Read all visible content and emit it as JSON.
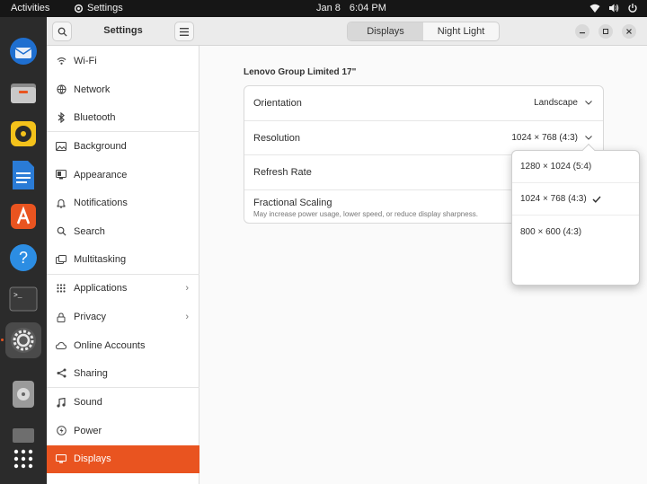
{
  "topbar": {
    "activities": "Activities",
    "app_name": "Settings",
    "date": "Jan 8",
    "time": "6:04 PM"
  },
  "dock": {
    "items": [
      "thunderbird",
      "files",
      "rhythmbox",
      "libreoffice-writer",
      "app-center",
      "help",
      "terminal",
      "settings",
      "disks",
      "trash",
      "show-apps"
    ]
  },
  "sidebar": {
    "title": "Settings",
    "items": [
      {
        "label": "Wi-Fi",
        "icon": "wifi-icon"
      },
      {
        "label": "Network",
        "icon": "network-icon"
      },
      {
        "label": "Bluetooth",
        "icon": "bluetooth-icon"
      },
      {
        "label": "Background",
        "icon": "background-icon"
      },
      {
        "label": "Appearance",
        "icon": "appearance-icon"
      },
      {
        "label": "Notifications",
        "icon": "bell-icon"
      },
      {
        "label": "Search",
        "icon": "search-icon"
      },
      {
        "label": "Multitasking",
        "icon": "multitasking-icon"
      },
      {
        "label": "Applications",
        "icon": "applications-icon"
      },
      {
        "label": "Privacy",
        "icon": "lock-icon"
      },
      {
        "label": "Online Accounts",
        "icon": "cloud-icon"
      },
      {
        "label": "Sharing",
        "icon": "share-icon"
      },
      {
        "label": "Sound",
        "icon": "music-note-icon"
      },
      {
        "label": "Power",
        "icon": "power-icon"
      },
      {
        "label": "Displays",
        "icon": "display-icon"
      }
    ],
    "selected": "Displays"
  },
  "header": {
    "tabs": [
      "Displays",
      "Night Light"
    ],
    "active_tab": "Displays"
  },
  "main": {
    "monitor_name": "Lenovo Group Limited 17\"",
    "orientation_label": "Orientation",
    "orientation_value": "Landscape",
    "resolution_label": "Resolution",
    "resolution_value": "1024 × 768 (4:3)",
    "refresh_label": "Refresh Rate",
    "scaling_label": "Fractional Scaling",
    "scaling_sub": "May increase power usage, lower speed, or reduce display sharpness."
  },
  "resolution_popover": {
    "options": [
      "1280 × 1024 (5:4)",
      "1024 × 768 (4:3)",
      "800 × 600 (4:3)"
    ],
    "selected": "1024 × 768 (4:3)"
  },
  "colors": {
    "accent": "#e95420",
    "topbar": "#161616",
    "dock": "#2b2b2b"
  }
}
